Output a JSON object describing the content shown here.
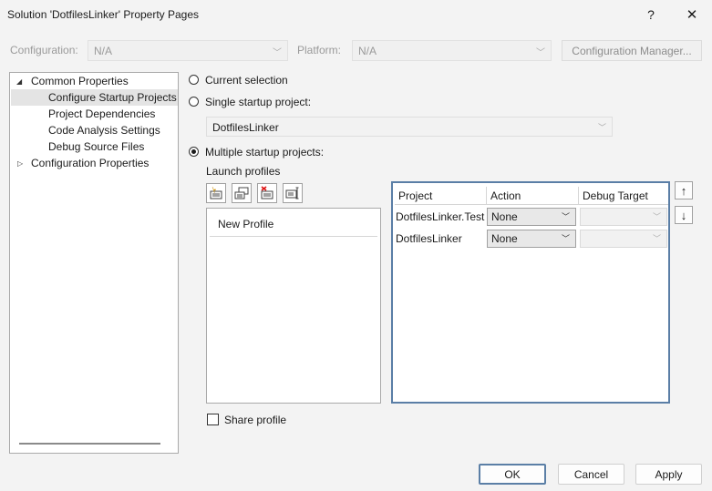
{
  "window": {
    "title": "Solution 'DotfilesLinker' Property Pages",
    "help_glyph": "?",
    "close_glyph": "✕"
  },
  "config_row": {
    "configuration_label": "Configuration:",
    "configuration_value": "N/A",
    "platform_label": "Platform:",
    "platform_value": "N/A",
    "config_manager_label": "Configuration Manager..."
  },
  "tree": {
    "items": [
      {
        "label": "Common Properties",
        "expander": "◢"
      },
      {
        "label": "Configure Startup Projects",
        "selected": true
      },
      {
        "label": "Project Dependencies"
      },
      {
        "label": "Code Analysis Settings"
      },
      {
        "label": "Debug Source Files"
      },
      {
        "label": "Configuration Properties",
        "expander": "▷"
      }
    ]
  },
  "startup": {
    "current_selection_label": "Current selection",
    "single_label": "Single startup project:",
    "single_value": "DotfilesLinker",
    "multiple_label": "Multiple startup projects:",
    "selected_option": "multiple"
  },
  "launch_profiles": {
    "label": "Launch profiles",
    "toolbar_icons": [
      "new-profile-icon",
      "duplicate-profile-icon",
      "delete-profile-icon",
      "rename-profile-icon"
    ],
    "profiles": [
      "New Profile"
    ]
  },
  "grid": {
    "headers": [
      "Project",
      "Action",
      "Debug Target"
    ],
    "rows": [
      {
        "project": "DotfilesLinker.Test",
        "action": "None",
        "debug_target": ""
      },
      {
        "project": "DotfilesLinker",
        "action": "None",
        "debug_target": ""
      }
    ],
    "move_up_glyph": "↑",
    "move_down_glyph": "↓"
  },
  "share_profile": {
    "label": "Share profile",
    "checked": false
  },
  "buttons": {
    "ok": "OK",
    "cancel": "Cancel",
    "apply": "Apply"
  },
  "colors": {
    "accent_border": "#5a7ea6",
    "selection_bg": "#e4e4e4"
  }
}
